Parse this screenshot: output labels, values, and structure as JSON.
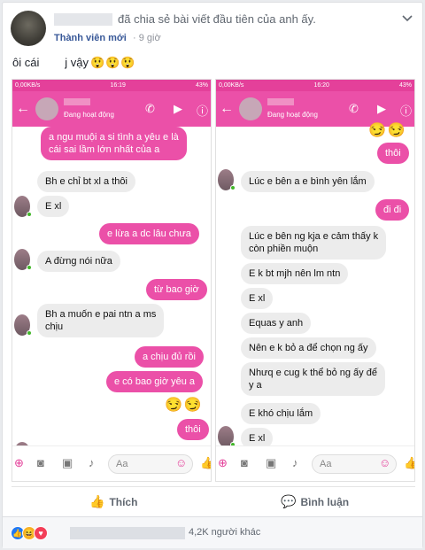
{
  "post": {
    "header_text": "đã chia sẻ bài viết đầu tiên của anh ấy.",
    "member_badge": "Thành viên mới",
    "time": "· 9 giờ",
    "text": "ôi cái        j vậy",
    "text_emoji": "😲😲😲"
  },
  "left_phone": {
    "status_left": "0,00KB/s",
    "time": "16:19",
    "battery": "43%",
    "active_status": "Đang hoạt động",
    "messages": [
      {
        "from": "out",
        "text": "a ngu muội a si tình a yêu e là\ncái sai lầm lớn nhất của a"
      },
      {
        "from": "in",
        "text": "Bh e chỉ bt xl a thôi"
      },
      {
        "from": "in",
        "text": "E xl"
      },
      {
        "from": "out",
        "text": "e lừa a dc lâu chưa"
      },
      {
        "from": "in",
        "text": "A đừng nói nữa"
      },
      {
        "from": "out",
        "text": "từ bao giờ"
      },
      {
        "from": "in",
        "text": "Bh a muốn e pai ntn a ms\nchịu"
      },
      {
        "from": "out",
        "text": "a chịu đủ rồi"
      },
      {
        "from": "out",
        "text": "e có bao giờ yêu a"
      },
      {
        "from": "out",
        "text": "thôi"
      }
    ],
    "emoji_row": "😏😏",
    "input_placeholder": "Aa"
  },
  "right_phone": {
    "status_left": "0,00KB/s",
    "time": "16:20",
    "battery": "43%",
    "active_status": "Đang hoạt động",
    "top_emoji": "😏😏",
    "messages": [
      {
        "from": "out",
        "text": "thôi"
      },
      {
        "from": "in",
        "text": "Lúc e bên a e bình yên lắm"
      },
      {
        "from": "out",
        "text": "đi đi"
      },
      {
        "from": "in",
        "text": "Lúc e bên ng kja e cảm thấy k\ncòn phiền muộn"
      },
      {
        "from": "in",
        "text": "E k bt mjh nên lm ntn"
      },
      {
        "from": "in",
        "text": "E xl"
      },
      {
        "from": "in",
        "text": "Equas y anh"
      },
      {
        "from": "in",
        "text": "Nên e k bỏ a để chọn ng ấy"
      },
      {
        "from": "in",
        "text": "Nhưq e cug k thể bỏ ng ấy để\ny a"
      },
      {
        "from": "in",
        "text": "E khó chịu lắm"
      },
      {
        "from": "in",
        "text": "E xl"
      }
    ],
    "input_placeholder": "Aa"
  },
  "actions": {
    "like": "Thích",
    "comment": "Bình luận"
  },
  "reactions": {
    "count_text": "4,2K người khác"
  },
  "colors": {
    "messenger_pink": "#eb50a8",
    "facebook_blue": "#385898"
  }
}
